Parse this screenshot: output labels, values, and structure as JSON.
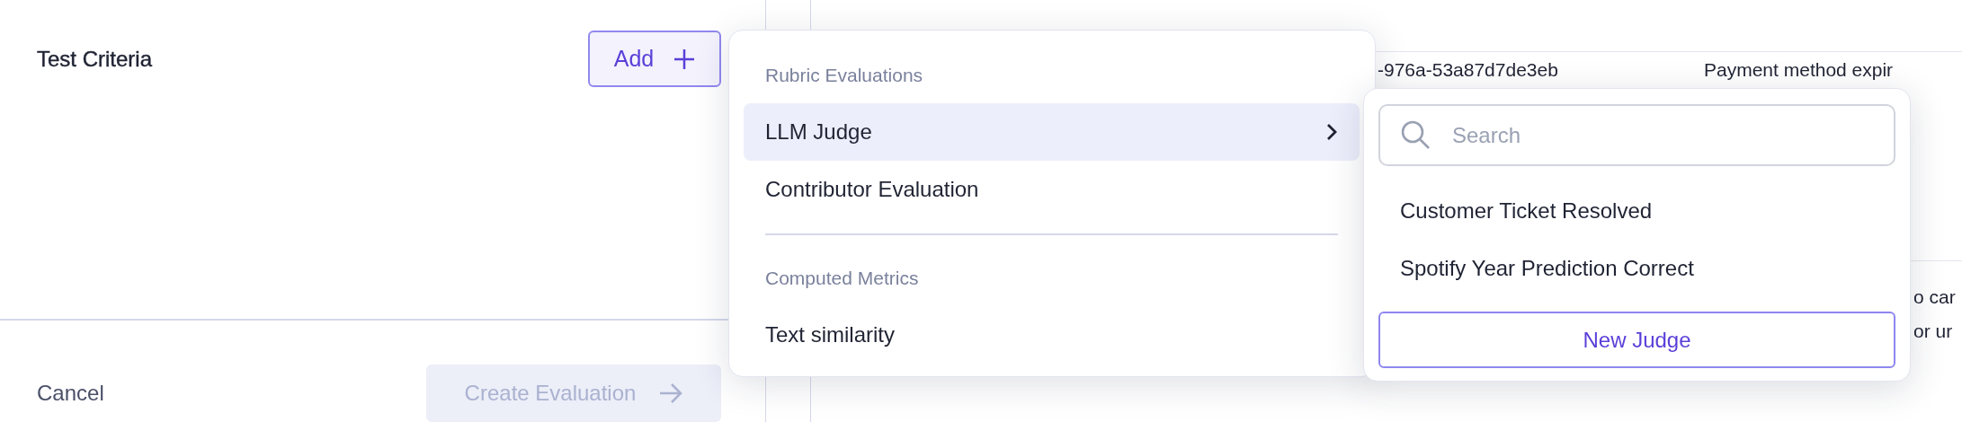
{
  "panel": {
    "title": "Test Criteria",
    "add_button": {
      "label": "Add"
    },
    "cancel": "Cancel",
    "create_button": {
      "label": "Create Evaluation",
      "disabled": true
    }
  },
  "background_table": {
    "rows": [
      {
        "cells": [
          [
            "-976a-53a87d7de3eb"
          ],
          [
            "Payment method expir"
          ]
        ]
      },
      {
        "cells": [
          [
            "o car",
            "or ur"
          ]
        ]
      }
    ]
  },
  "menu": {
    "sections": [
      {
        "heading": "Rubric Evaluations",
        "items": [
          {
            "label": "LLM Judge",
            "selected": true,
            "has_submenu": true
          },
          {
            "label": "Contributor Evaluation",
            "selected": false,
            "has_submenu": false
          }
        ]
      },
      {
        "heading": "Computed Metrics",
        "items": [
          {
            "label": "Text similarity",
            "selected": false,
            "has_submenu": false
          }
        ]
      }
    ]
  },
  "submenu": {
    "search": {
      "placeholder": "Search"
    },
    "items": [
      "Customer Ticket Resolved",
      "Spotify Year Prediction Correct"
    ],
    "button": {
      "label": "New Judge"
    }
  }
}
